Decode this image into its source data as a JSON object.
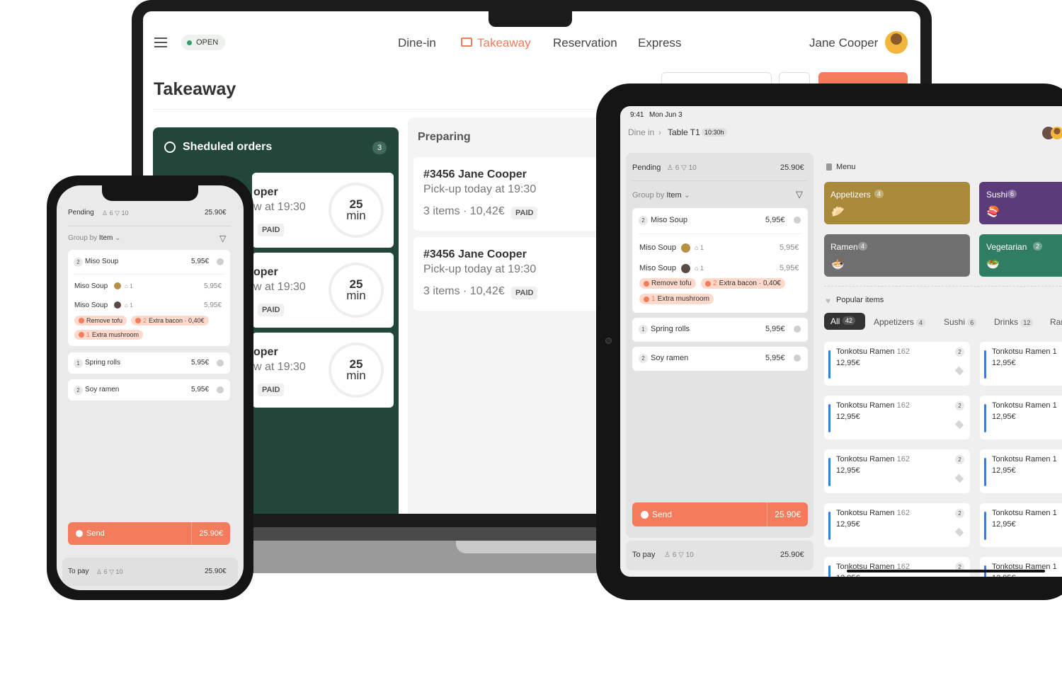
{
  "laptop": {
    "status": "OPEN",
    "nav": [
      "Dine-in",
      "Takeaway",
      "Reservation",
      "Express"
    ],
    "user": "Jane Cooper",
    "page_title": "Takeaway",
    "scheduled": {
      "title": "Sheduled orders",
      "count": "3",
      "cards": [
        {
          "name": "oper",
          "time": "w at 19:30",
          "paid": "PAID",
          "minutes": "25",
          "unit": "min"
        },
        {
          "name": "oper",
          "time": "w at 19:30",
          "paid": "PAID",
          "minutes": "25",
          "unit": "min"
        },
        {
          "name": "oper",
          "time": "w at 19:30",
          "paid": "PAID",
          "minutes": "25",
          "unit": "min"
        }
      ]
    },
    "preparing": {
      "title": "Preparing",
      "cards": [
        {
          "title": "#3456 Jane Cooper",
          "pickup": "Pick-up today at 19:30",
          "summary": "3 items · 10,42€",
          "paid": "PAID"
        },
        {
          "title": "#3456 Jane Cooper",
          "pickup": "Pick-up today at 19:30",
          "summary": "3 items · 10,42€",
          "paid": "PAID"
        }
      ]
    }
  },
  "order": {
    "pending_label": "Pending",
    "guests": "6",
    "items_count": "10",
    "total": "25.90€",
    "group_prefix": "Group by",
    "group_value": "Item",
    "miso": {
      "qty": "2",
      "name": "Miso Soup",
      "price": "5,95€"
    },
    "sub_items": [
      {
        "name": "Miso Soup",
        "count": "1",
        "price": "5,95€"
      },
      {
        "name": "Miso Soup",
        "count": "1",
        "price": "5,95€"
      }
    ],
    "modifiers": {
      "remove": "Remove tofu",
      "bacon_qty": "2",
      "bacon": "Extra bacon · 0,40€",
      "mush_qty": "1",
      "mushroom": "Extra mushroom"
    },
    "items": [
      {
        "qty": "1",
        "name": "Spring rolls",
        "price": "5,95€"
      },
      {
        "qty": "2",
        "name": "Soy ramen",
        "price": "5,95€"
      }
    ],
    "send_label": "Send",
    "send_total": "25.90€",
    "to_pay_label": "To pay",
    "to_pay_total": "25.90€"
  },
  "tablet": {
    "time": "9:41",
    "date": "Mon Jun 3",
    "crumb_root": "Dine in",
    "crumb_table": "Table T1",
    "crumb_time": "10:30h",
    "menu_title": "Menu",
    "categories": [
      {
        "name": "Appetizers",
        "count": "4",
        "color": "#a88a3a"
      },
      {
        "name": "Sushi",
        "count": "6",
        "color": "#5b3b7a"
      },
      {
        "name": "Ramen",
        "count": "4",
        "color": "#6f6f6f"
      },
      {
        "name": "Vegetarian",
        "count": "2",
        "color": "#2f7d63"
      }
    ],
    "popular_title": "Popular items",
    "filters": [
      {
        "name": "All",
        "count": "42"
      },
      {
        "name": "Appetizers",
        "count": "4"
      },
      {
        "name": "Sushi",
        "count": "6"
      },
      {
        "name": "Drinks",
        "count": "12"
      },
      {
        "name": "Rar",
        "count": ""
      }
    ],
    "tile": {
      "name": "Tonkotsu Ramen",
      "code": "162",
      "qty": "2",
      "price": "12,95€",
      "name_cut": "Tonkotsu Ramen 1"
    }
  }
}
